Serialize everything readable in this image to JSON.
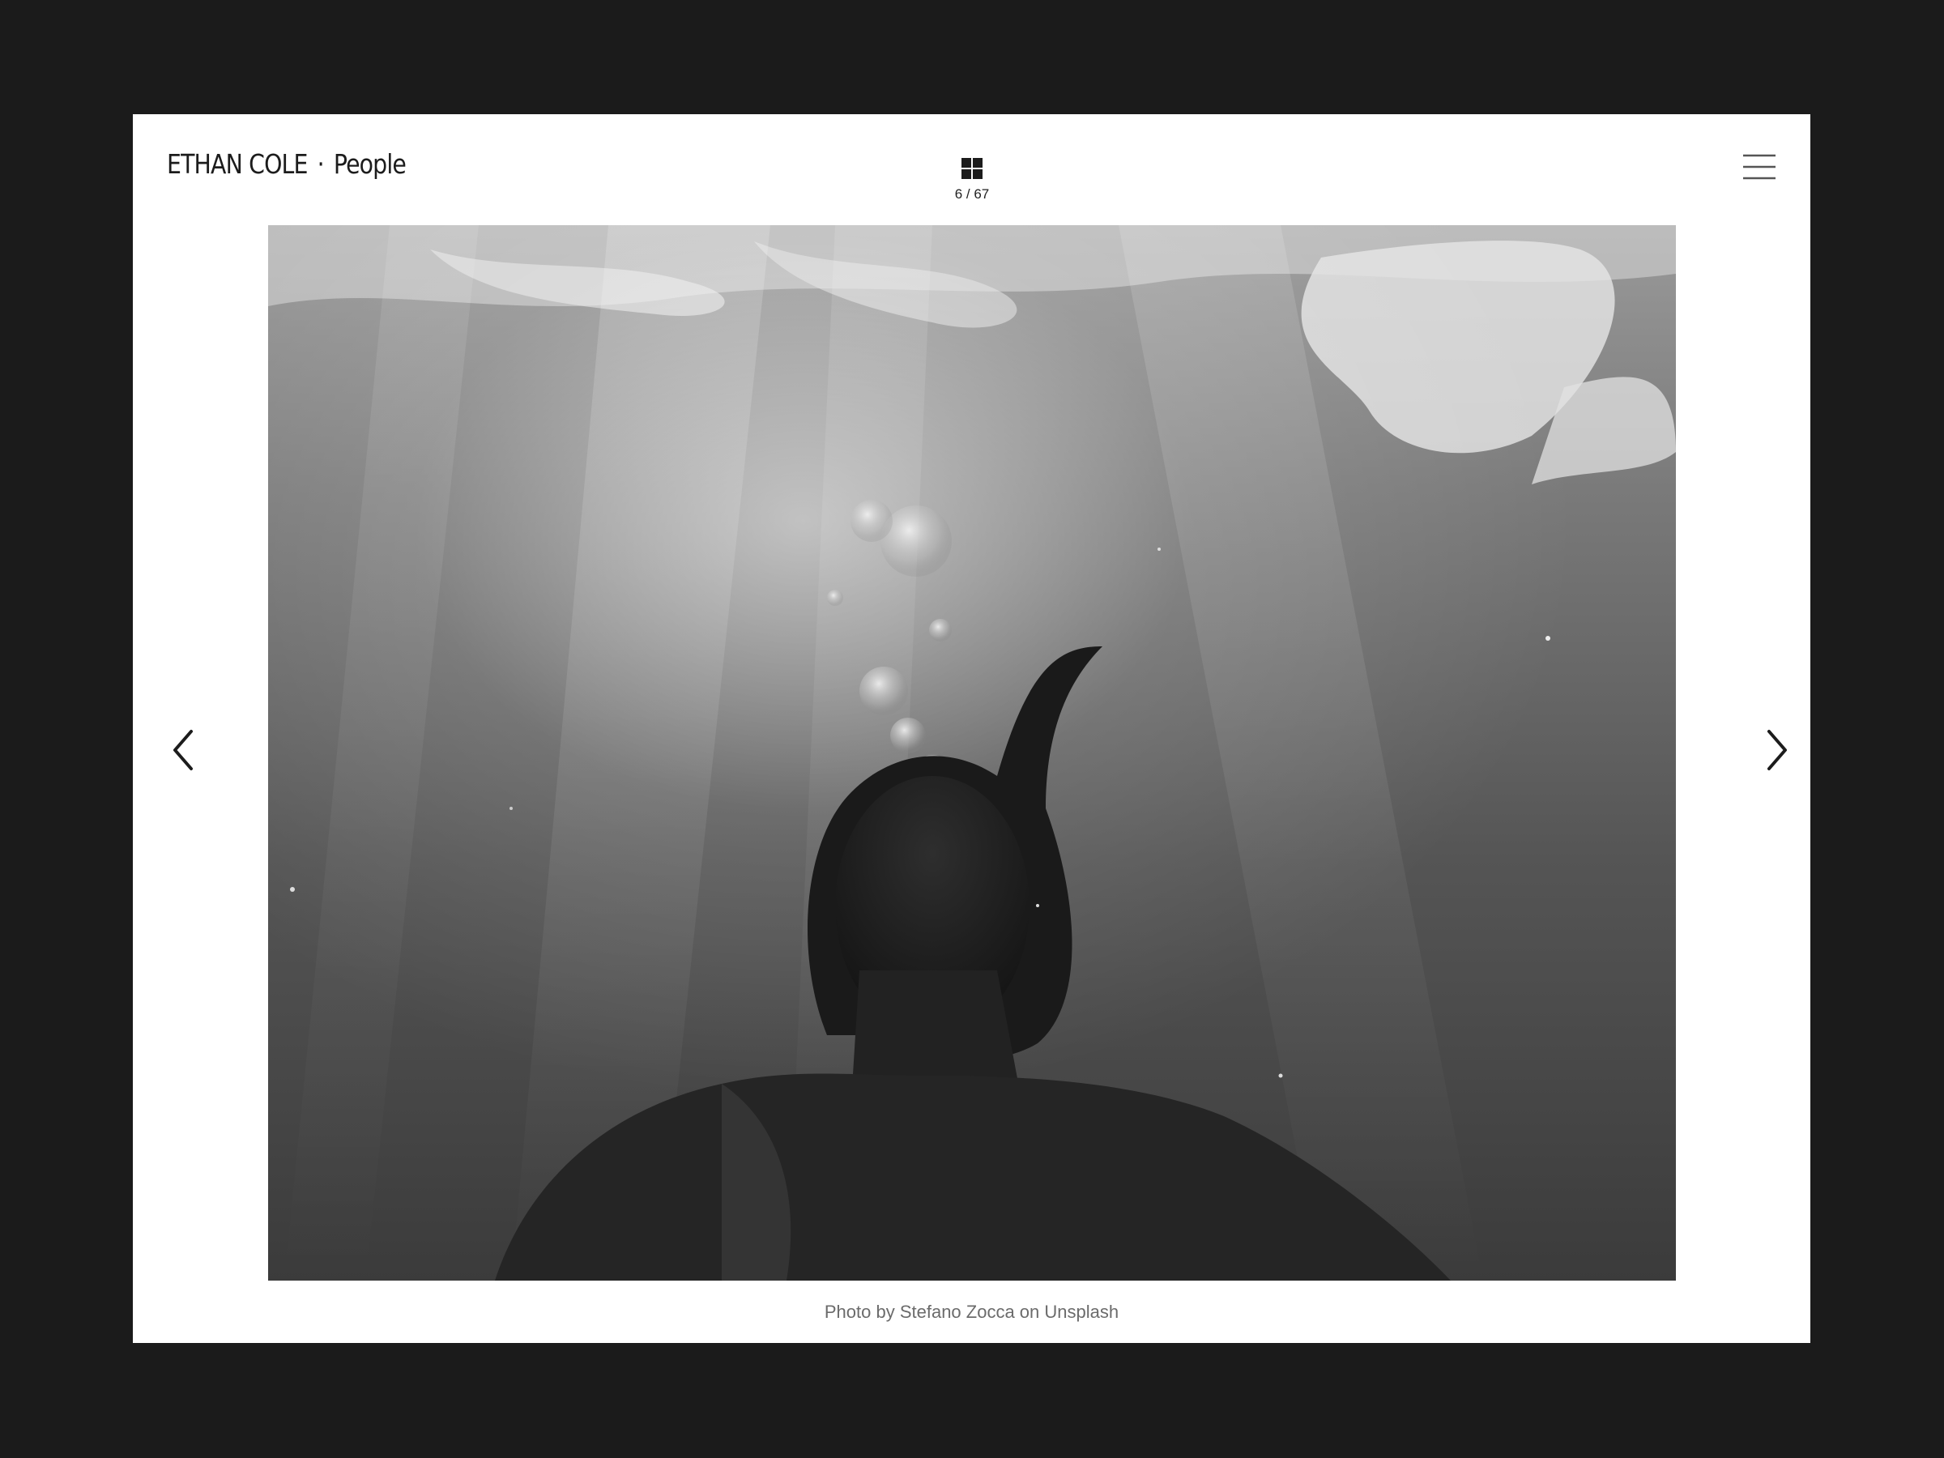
{
  "header": {
    "brand_name": "ETHAN COLE",
    "separator": "·",
    "section": "People"
  },
  "toolbar": {
    "grid_icon": "grid-icon",
    "counter": "6 / 67",
    "menu_icon": "hamburger-menu-icon"
  },
  "gallery": {
    "prev_icon": "chevron-left-icon",
    "next_icon": "chevron-right-icon",
    "caption": "Photo by Stefano Zocca on Unsplash"
  },
  "colors": {
    "background": "#1b1b1b",
    "frame": "#ffffff",
    "text": "#1c1c1c",
    "caption": "#6b6b6b"
  }
}
